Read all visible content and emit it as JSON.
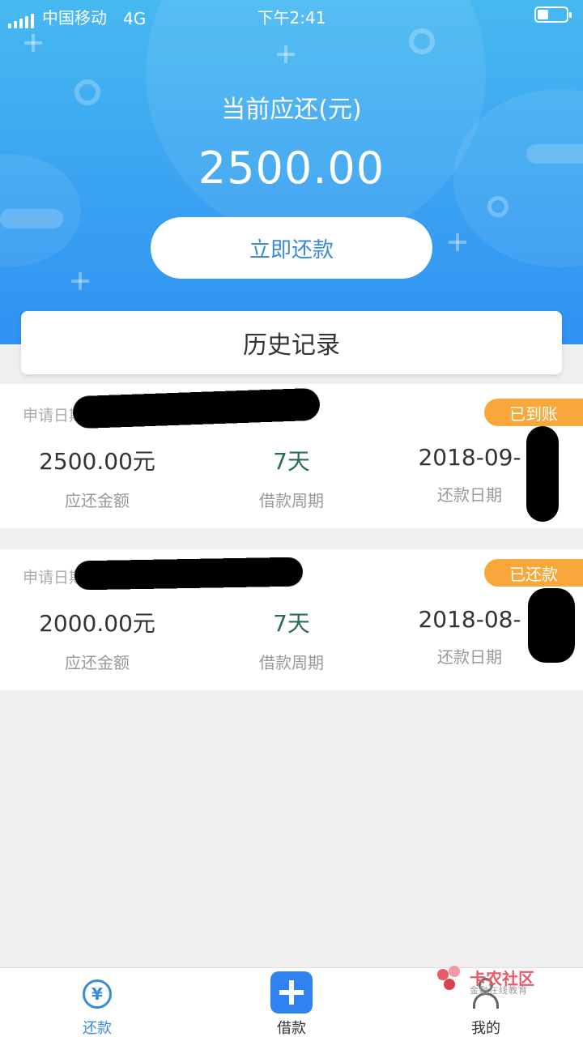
{
  "status_bar": {
    "carrier": "中国移动",
    "network": "4G",
    "time": "下午2:41"
  },
  "summary": {
    "due_label": "当前应还(元)",
    "due_amount": "2500.00",
    "repay_button": "立即还款"
  },
  "history": {
    "title": "历史记录"
  },
  "records": [
    {
      "date_label": "申请日期",
      "status": "已到账",
      "amount": "2500.00元",
      "amount_label": "应还金额",
      "period": "7天",
      "period_label": "借款周期",
      "due_date": "2018-09-",
      "due_date_label": "还款日期"
    },
    {
      "date_label": "申请日期",
      "status": "已还款",
      "amount": "2000.00元",
      "amount_label": "应还金额",
      "period": "7天",
      "period_label": "借款周期",
      "due_date": "2018-08-",
      "due_date_label": "还款日期"
    }
  ],
  "tabs": [
    {
      "label": "还款",
      "icon": "yen-circle-icon",
      "active": true
    },
    {
      "label": "借款",
      "icon": "plus-icon",
      "active": false
    },
    {
      "label": "我的",
      "icon": "person-icon",
      "active": false
    }
  ],
  "watermark": {
    "title": "卡农社区",
    "subtitle": "金融在线教育"
  },
  "colors": {
    "header_top": "#47b9f1",
    "header_bottom": "#2f91f2",
    "accent": "#3a8ad8",
    "badge": "#f8a83a"
  }
}
